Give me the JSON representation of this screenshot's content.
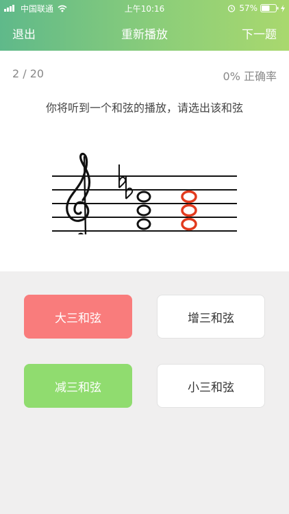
{
  "status": {
    "carrier": "中国联通",
    "time": "上午10:16",
    "battery": "57%"
  },
  "nav": {
    "exit": "退出",
    "replay": "重新播放",
    "next": "下一题"
  },
  "quiz": {
    "progress": "2 / 20",
    "accuracy": "0% 正确率",
    "question": "你将听到一个和弦的播放，请选出该和弦"
  },
  "answers": [
    {
      "label": "大三和弦",
      "state": "wrong",
      "color": "#f97c7c"
    },
    {
      "label": "增三和弦",
      "state": "neutral",
      "color": "#ffffff"
    },
    {
      "label": "减三和弦",
      "state": "correct",
      "color": "#90dc6f"
    },
    {
      "label": "小三和弦",
      "state": "neutral",
      "color": "#ffffff"
    }
  ],
  "colors": {
    "header_start": "#5fb98a",
    "header_end": "#a9d86e",
    "wrong_note": "#e23a1e"
  }
}
